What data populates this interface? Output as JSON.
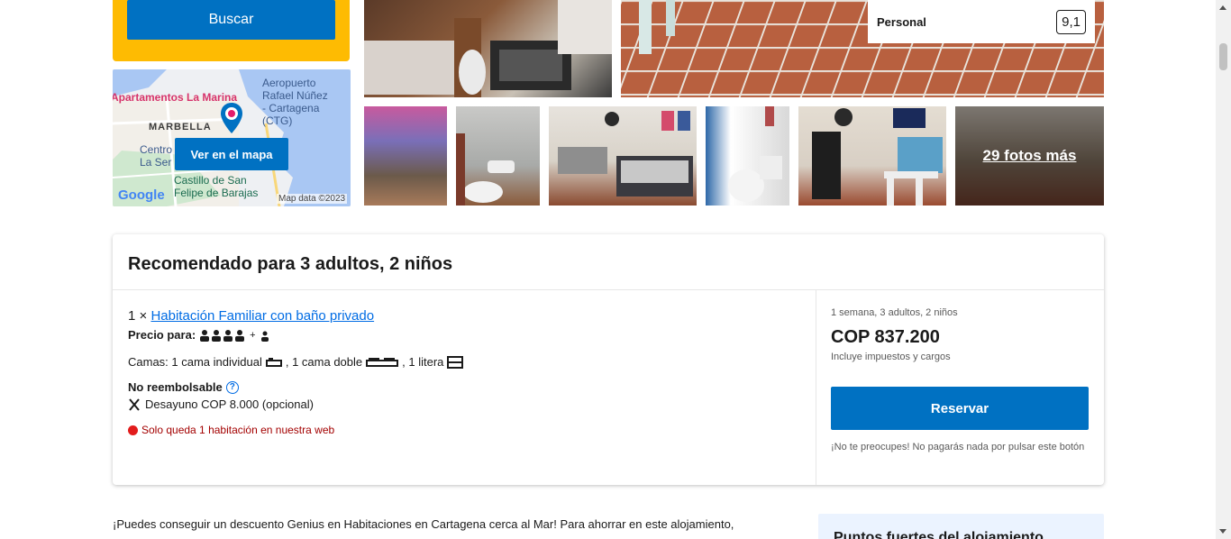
{
  "search": {
    "button_label": "Buscar"
  },
  "map": {
    "labels": {
      "apartments": "Apartamentos La Marina",
      "airport_line1": "Aeropuerto",
      "airport_line2": "Rafael Núñez",
      "airport_line3": "- Cartagena",
      "airport_line4": "(CTG)",
      "marbella": "MARBELLA",
      "centro_line1": "Centro",
      "centro_line2": "La Ser",
      "castillo_line1": "Castillo de San",
      "castillo_line2": "Felipe de Barajas",
      "google": "Google",
      "map_data": "Map data ©2023"
    },
    "button_label": "Ver en el mapa"
  },
  "gallery": {
    "personal_label": "Personal",
    "personal_score": "9,1",
    "more_photos_label": "29 fotos más"
  },
  "recommendation": {
    "title": "Recomendado para 3 adultos, 2 niños",
    "room_prefix": "1 ×",
    "room_name": "Habitación Familiar con baño privado",
    "price_for_label": "Precio para:",
    "price_for_plus": "+",
    "beds_label": "Camas: 1 cama individual",
    "beds_double": ", 1 cama doble",
    "beds_bunk": ", 1 litera",
    "non_refundable": "No reembolsable",
    "info_icon": "?",
    "breakfast": "Desayuno COP 8.000 (opcional)",
    "urgency": "Solo queda 1 habitación en nuestra web",
    "stay_info": "1 semana, 3 adultos, 2 niños",
    "price": "COP 837.200",
    "taxes": "Incluye impuestos y cargos",
    "reserve_label": "Reservar",
    "no_worry": "¡No te preocupes! No pagarás nada por pulsar este botón"
  },
  "genius_text": "¡Puedes conseguir un descuento Genius en Habitaciones en Cartagena cerca al Mar! Para ahorrar en este alojamiento,",
  "highlights_title": "Puntos fuertes del alojamiento",
  "colors": {
    "brand_blue": "#0071c2",
    "link_blue": "#006ce4",
    "search_yellow": "#febb02",
    "urgency_red": "#a30000"
  }
}
